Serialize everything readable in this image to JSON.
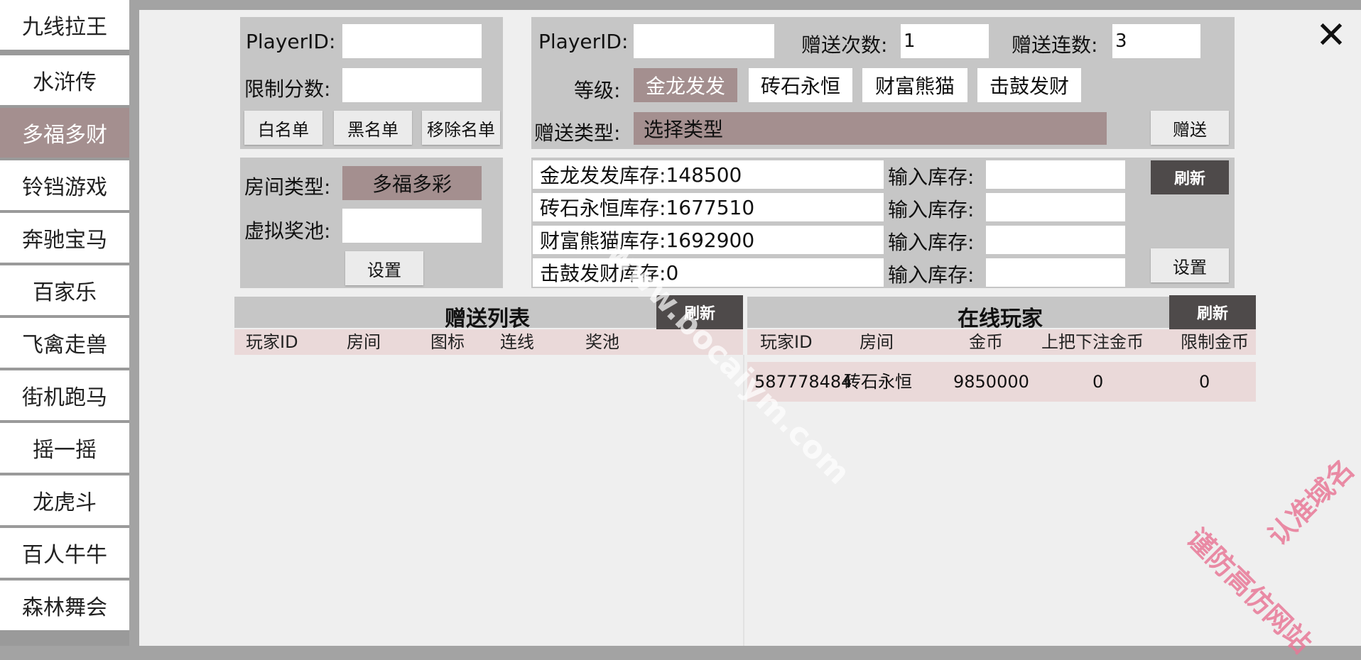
{
  "sidebar": {
    "items": [
      {
        "label": "九线拉王"
      },
      {
        "label": "水浒传"
      },
      {
        "label": "多福多财"
      },
      {
        "label": "铃铛游戏"
      },
      {
        "label": "奔驰宝马"
      },
      {
        "label": "百家乐"
      },
      {
        "label": "飞禽走兽"
      },
      {
        "label": "街机跑马"
      },
      {
        "label": "摇一摇"
      },
      {
        "label": "龙虎斗"
      },
      {
        "label": "百人牛牛"
      },
      {
        "label": "森林舞会"
      }
    ],
    "active_index": 2
  },
  "close_icon": "close-icon",
  "list_panel": {
    "player_id_label": "PlayerID:",
    "player_id_value": "",
    "limit_label": "限制分数:",
    "limit_value": "",
    "whitelist_button": "白名单",
    "blacklist_button": "黑名单",
    "remove_button": "移除名单"
  },
  "gift_panel": {
    "player_id_label": "PlayerID:",
    "player_id_value": "",
    "count_label": "赠送次数:",
    "count_value": "1",
    "combo_label": "赠送连数:",
    "combo_value": "3",
    "level_label": "等级:",
    "levels": [
      "金龙发发",
      "砖石永恒",
      "财富熊猫",
      "击鼓发财"
    ],
    "selected_level": "金龙发发",
    "type_label": "赠送类型:",
    "type_value": "选择类型",
    "send_button": "赠送"
  },
  "room_panel": {
    "room_type_label": "房间类型:",
    "room_type_value": "多福多彩",
    "pool_label": "虚拟奖池:",
    "pool_value": "",
    "set_button": "设置"
  },
  "stock_panel": {
    "rows": [
      {
        "label": "金龙发发库存:",
        "value": "148500",
        "input_label": "输入库存:",
        "input_value": ""
      },
      {
        "label": "砖石永恒库存:",
        "value": "1677510",
        "input_label": "输入库存:",
        "input_value": ""
      },
      {
        "label": "财富熊猫库存:",
        "value": "1692900",
        "input_label": "输入库存:",
        "input_value": ""
      },
      {
        "label": "击鼓发财库存:",
        "value": "0",
        "input_label": "输入库存:",
        "input_value": ""
      }
    ],
    "refresh_button": "刷新",
    "set_button": "设置"
  },
  "gift_list": {
    "title": "赠送列表",
    "refresh_button": "刷新",
    "columns": [
      "玩家ID",
      "房间",
      "图标",
      "连线",
      "奖池"
    ],
    "rows": []
  },
  "online_players": {
    "title": "在线玩家",
    "refresh_button": "刷新",
    "columns": [
      "玩家ID",
      "房间",
      "金币",
      "上把下注金币",
      "限制金币"
    ],
    "rows": [
      {
        "player_id": "587778484",
        "room": "砖石永恒",
        "coins": "9850000",
        "last_bet": "0",
        "limit": "0"
      }
    ]
  },
  "watermark": {
    "text": "www.bocaiym.com",
    "stamp_line1": "认准域名",
    "stamp_line2": "谨防高仿网站"
  },
  "colors": {
    "accent": "#a48f8f",
    "panel": "#c6c6c6",
    "dark_button": "#4e4a4a",
    "row_pink": "#ead9d9"
  }
}
